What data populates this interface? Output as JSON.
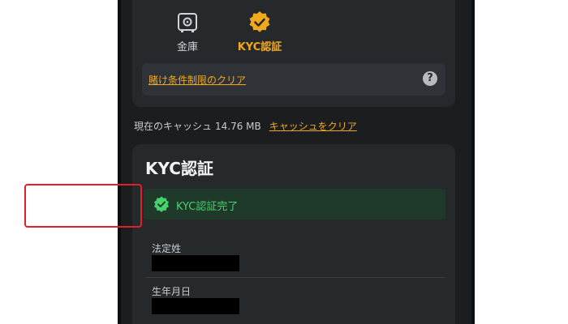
{
  "tabs": [
    {
      "label": "金庫",
      "icon": "safe-icon",
      "active": false
    },
    {
      "label": "KYC認証",
      "icon": "verified-badge-icon",
      "active": true
    }
  ],
  "wager": {
    "clear_link": "賭け条件制限のクリア",
    "help_icon": "?"
  },
  "cache": {
    "label": "現在のキャッシュ",
    "size": "14.76 MB",
    "clear_link": "キャッシュをクリア"
  },
  "kyc": {
    "title": "KYC認証",
    "status_text": "KYC認証完了",
    "status_color": "#46d36b",
    "fields": [
      {
        "label": "法定姓"
      },
      {
        "label": "生年月日"
      }
    ]
  },
  "colors": {
    "accent": "#f0a81c",
    "highlight": "#e0202a",
    "background": "#1b1d1f",
    "card": "#26292c"
  }
}
